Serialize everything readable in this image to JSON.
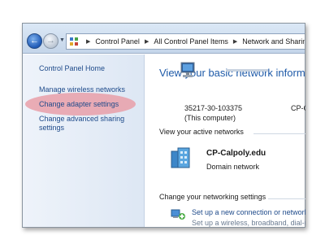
{
  "address_bar": {
    "crumbs": [
      "Control Panel",
      "All Control Panel Items",
      "Network and Sharing Center"
    ]
  },
  "nav": {
    "home": "Control Panel Home",
    "links": [
      "Manage wireless networks",
      "Change adapter settings",
      "Change advanced sharing",
      "settings"
    ]
  },
  "main": {
    "title": "View your basic network information and set up connections",
    "computer_name": "35217-30-103375",
    "computer_note": "(This computer)",
    "network_node": "CP-Calpoly.edu",
    "active_heading": "View your active networks",
    "network_name": "CP-Calpoly.edu",
    "network_type": "Domain network",
    "settings_heading": "Change your networking settings",
    "tasks": [
      "Set up a new connection or network",
      "Set up a wireless, broadband, dial-up, ad hoc, or VPN connection"
    ]
  },
  "colors": {
    "link": "#1e4a8a",
    "title": "#1e5aa8",
    "highlight": "#e89aa4"
  }
}
